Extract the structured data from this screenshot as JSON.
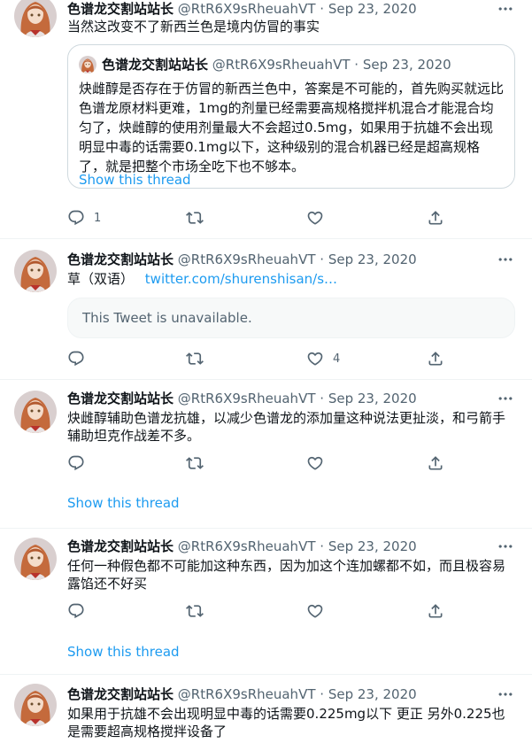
{
  "tweets": [
    {
      "name": "色谱龙交割站站长",
      "handle": "@RtR6X9sRheuahVT",
      "dot": "·",
      "date": "Sep 23, 2020",
      "text": "当然这改变不了新西兰色是境内仿冒的事实",
      "quote": {
        "name": "色谱龙交割站站长",
        "handle": "@RtR6X9sRheuahVT",
        "dot": "·",
        "date": "Sep 23, 2020",
        "text": "炔雌醇是否存在于仿冒的新西兰色中，答案是不可能的，首先购买就远比色谱龙原材料更难，1mg的剂量已经需要高规格搅拌机混合才能混合均匀了，炔雌醇的使用剂量最大不会超过0.5mg，如果用于抗雄不会出现明显中毒的话需要0.1mg以下，这种级别的混合机器已经是超高规格了，就是把整个市场全吃下也不够本。",
        "show_thread": "Show this thread"
      },
      "replies": "1",
      "retweets": "",
      "likes": ""
    },
    {
      "name": "色谱龙交割站站长",
      "handle": "@RtR6X9sRheuahVT",
      "dot": "·",
      "date": "Sep 23, 2020",
      "text": "草（双语）",
      "link": "twitter.com/shurenshisan/s…",
      "unavailable": "This Tweet is unavailable.",
      "replies": "",
      "retweets": "",
      "likes": "4"
    },
    {
      "name": "色谱龙交割站站长",
      "handle": "@RtR6X9sRheuahVT",
      "dot": "·",
      "date": "Sep 23, 2020",
      "text": "炔雌醇辅助色谱龙抗雄，以减少色谱龙的添加量这种说法更扯淡，和弓箭手辅助坦克作战差不多。",
      "show_thread": "Show this thread"
    },
    {
      "name": "色谱龙交割站站长",
      "handle": "@RtR6X9sRheuahVT",
      "dot": "·",
      "date": "Sep 23, 2020",
      "text": "任何一种假色都不可能加这种东西，因为加这个连加螺都不如，而且极容易露馅还不好买",
      "show_thread": "Show this thread"
    },
    {
      "name": "色谱龙交割站站长",
      "handle": "@RtR6X9sRheuahVT",
      "dot": "·",
      "date": "Sep 23, 2020",
      "text": "如果用于抗雄不会出现明显中毒的话需要0.225mg以下  更正 另外0.225也是需要超高规格搅拌设备了"
    }
  ],
  "icons": {
    "reply": "reply-icon",
    "retweet": "retweet-icon",
    "like": "heart-icon",
    "share": "share-icon",
    "more": "more-icon"
  },
  "colors": {
    "accent": "#1d9bf0",
    "secondary_text": "#536471",
    "border": "#eff3f4"
  }
}
